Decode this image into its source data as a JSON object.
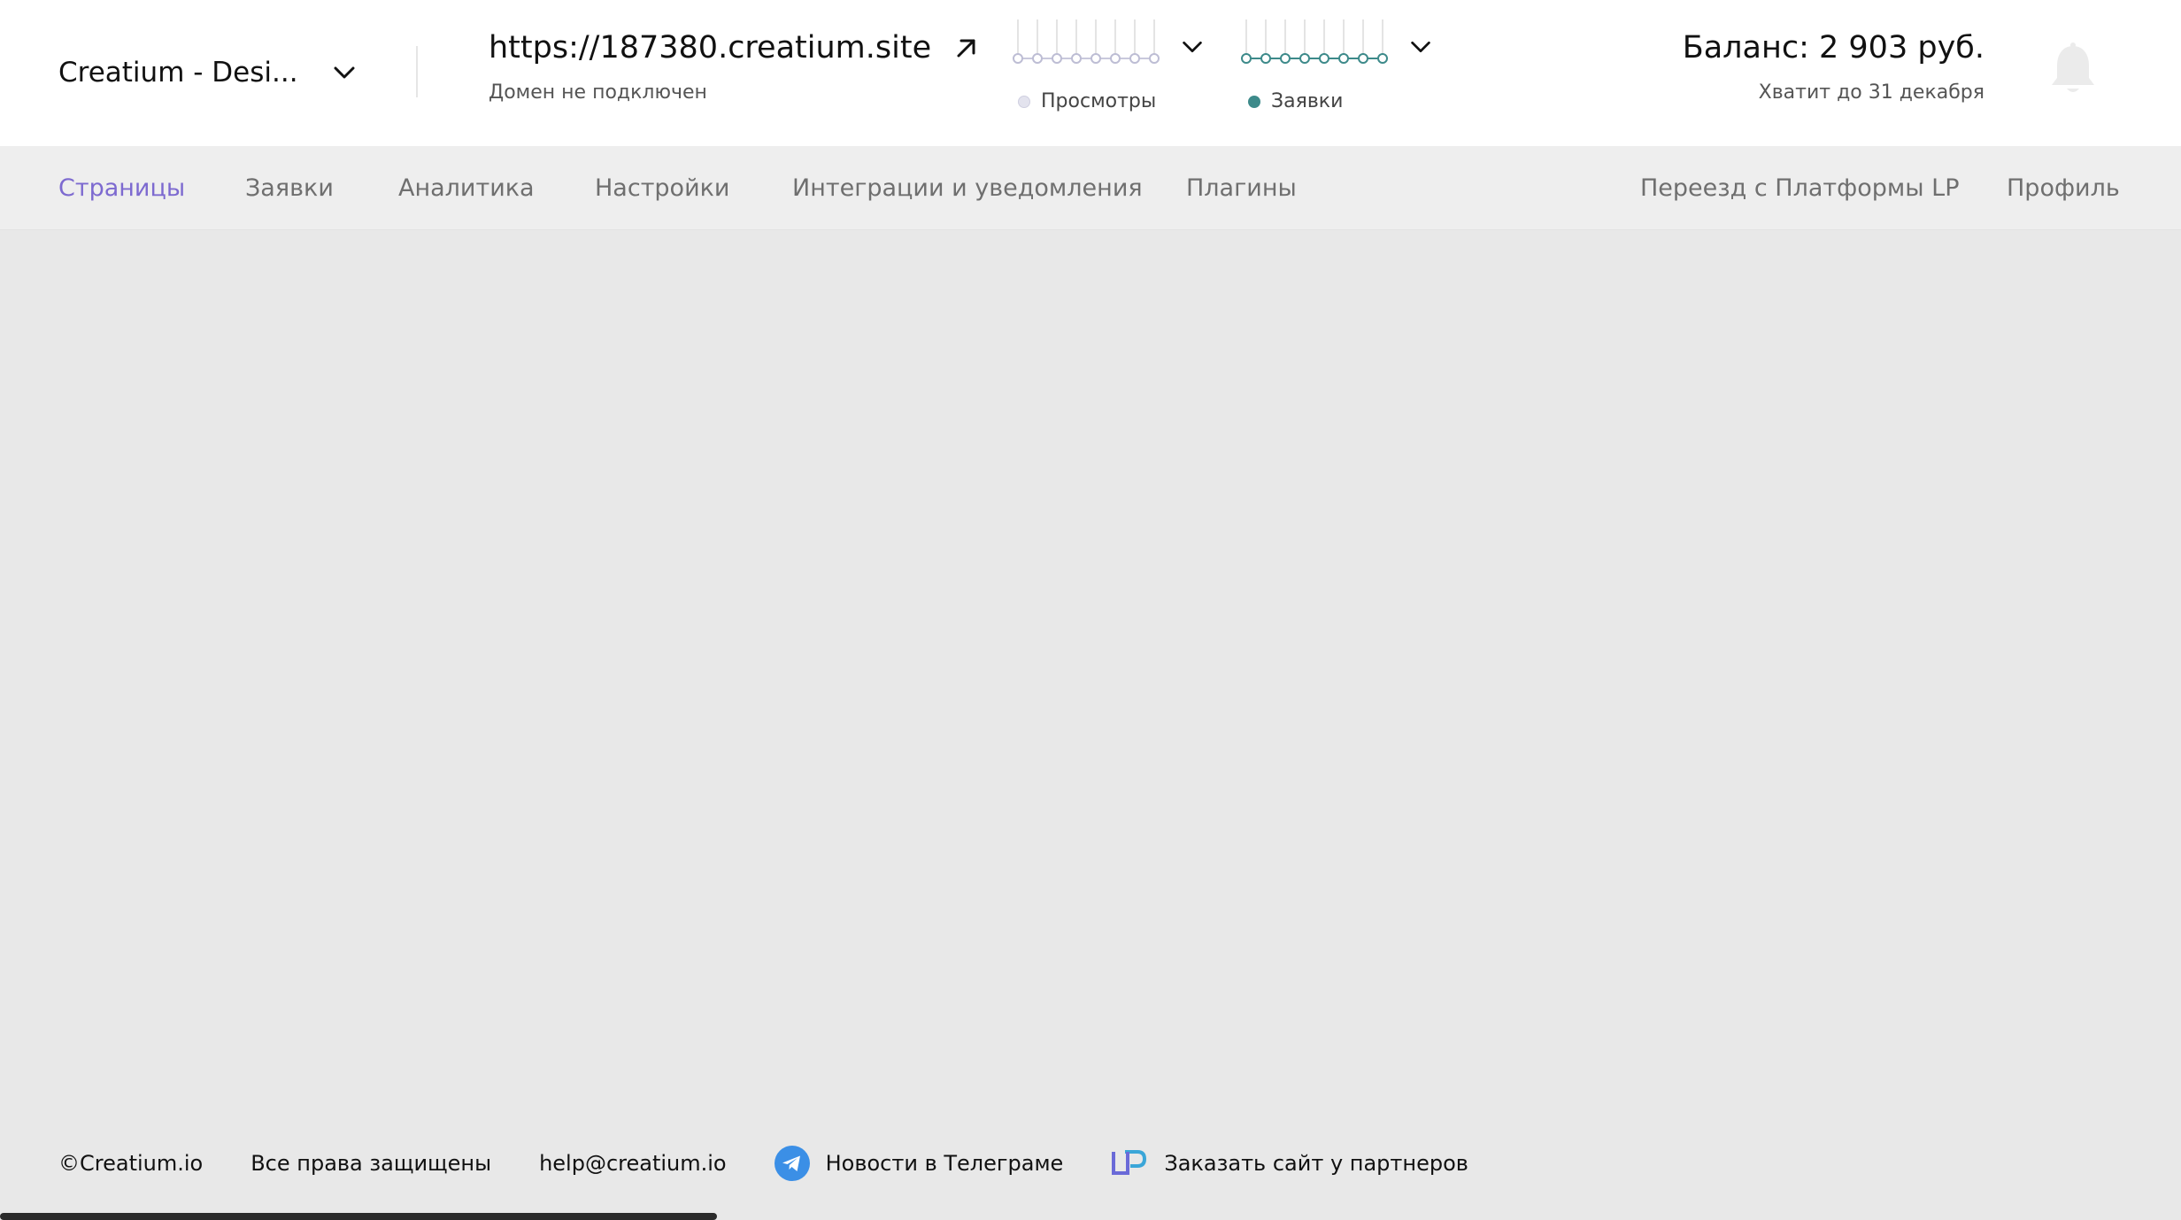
{
  "header": {
    "project_name": "Creatium - Desi...",
    "site_url": "https://187380.creatium.site",
    "domain_status": "Домен не подключен",
    "stats": {
      "views_label": "Просмотры",
      "leads_label": "Заявки",
      "views_color": "#d8d8f0",
      "leads_color": "#3d8a8a",
      "views_values": [
        0,
        0,
        0,
        0,
        0,
        0,
        0,
        0
      ],
      "leads_values": [
        0,
        0,
        0,
        0,
        0,
        0,
        0,
        0
      ]
    },
    "balance_title": "Баланс: 2 903 руб.",
    "balance_sub": "Хватит до 31 декабря"
  },
  "nav": {
    "pages": "Страницы",
    "leads": "Заявки",
    "analytics": "Аналитика",
    "settings": "Настройки",
    "integrations": "Интеграции и уведомления",
    "plugins": "Плагины",
    "migration": "Переезд с Платформы LP",
    "profile": "Профиль",
    "active_color": "#7d6ad0"
  },
  "footer": {
    "copyright": "©Creatium.io",
    "rights": "Все права защищены",
    "email": "help@creatium.io",
    "telegram": "Новости в Телеграме",
    "partners": "Заказать сайт у партнеров"
  },
  "icons": {
    "project_chevron": "chevron-down-icon",
    "external_link": "arrow-up-right-icon",
    "bell": "bell-icon",
    "telegram": "telegram-icon",
    "partners": "lp-icon"
  }
}
